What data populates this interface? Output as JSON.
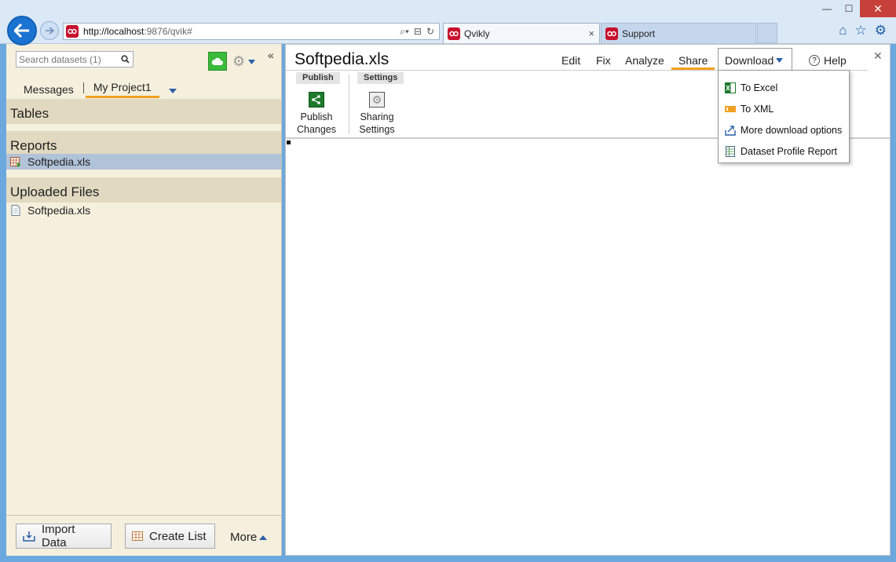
{
  "browser": {
    "url_host": "http://localhost",
    "url_path": ":9876/qvik#",
    "tabs": [
      {
        "label": "Qvikly",
        "close": "×"
      },
      {
        "label": "Support"
      }
    ]
  },
  "sidebar": {
    "search_placeholder": "Search datasets (1)",
    "collapse_glyph": "«",
    "project_tabs": [
      "Messages",
      "My Project1"
    ],
    "sections": {
      "tables": {
        "heading": "Tables"
      },
      "reports": {
        "heading": "Reports",
        "items": [
          "Softpedia.xls"
        ]
      },
      "uploaded": {
        "heading": "Uploaded Files",
        "items": [
          "Softpedia.xls"
        ]
      }
    },
    "bottom": {
      "import_label": "Import Data",
      "create_list_label": "Create List",
      "more_label": "More"
    }
  },
  "main": {
    "title": "Softpedia.xls",
    "menu": [
      "Edit",
      "Fix",
      "Analyze",
      "Share",
      "Download",
      "Help"
    ],
    "active_menu": "Share",
    "close_glyph": "✕",
    "toolbar": {
      "groups": [
        "Publish",
        "Settings"
      ],
      "publish_line1": "Publish",
      "publish_line2": "Changes",
      "sharing_line1": "Sharing",
      "sharing_line2": "Settings"
    }
  },
  "download_menu": {
    "items": [
      "To Excel",
      "To XML",
      "More download options",
      "Dataset Profile Report"
    ]
  },
  "colors": {
    "accent_underline": "#f0a020",
    "sidebar_bg": "#f5f0dd",
    "section_bg": "#e2d9c1",
    "selected_row": "#b1c3d9",
    "brand_red": "#c8102e"
  }
}
